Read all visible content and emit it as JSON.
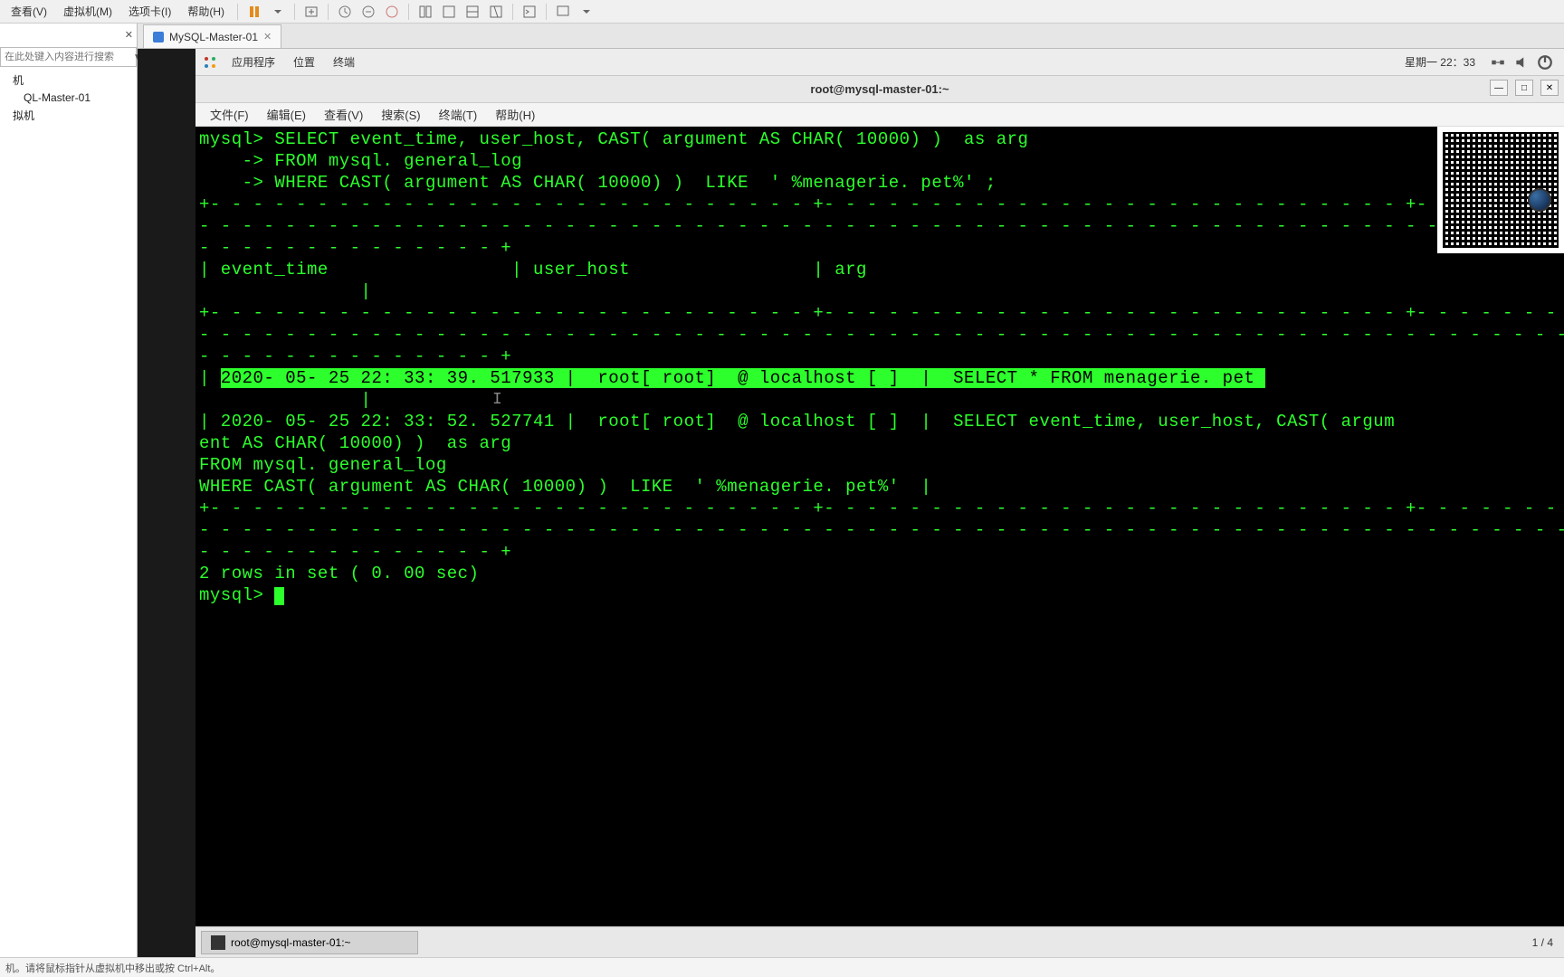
{
  "vm_menu": {
    "m0": "查看(V)",
    "m1": "虚拟机(M)",
    "m2": "选项卡(I)",
    "m3": "帮助(H)"
  },
  "sidebar": {
    "search_placeholder": "在此处键入内容进行搜索",
    "n0": "机",
    "n1": "QL-Master-01",
    "n2": "拟机"
  },
  "tab": {
    "label": "MySQL-Master-01"
  },
  "gnome": {
    "apps": "应用程序",
    "places": "位置",
    "terminal": "终端",
    "clock": "星期一  22：33"
  },
  "term": {
    "title": "root@mysql-master-01:~",
    "menu": {
      "file": "文件(F)",
      "edit": "编辑(E)",
      "view": "查看(V)",
      "search": "搜索(S)",
      "terminal": "终端(T)",
      "help": "帮助(H)"
    },
    "l1": "mysql> SELECT event_time, user_host, CAST( argument AS CHAR( 10000) )  as arg",
    "l2": "    -> FROM mysql. general_log",
    "l3": "    -> WHERE CAST( argument AS CHAR( 10000) )  LIKE  ' %menagerie. pet%' ;",
    "l4": "+- - - - - - - - - - - - - - - - - - - - - - - - - - - - +- - - - - - - - - - - - - - - - - - - - - - - - - - - +- - - - - - - - - - - - - - - - - - - - - - - - - - - - - - - - - - -",
    "l5": "- - - - - - - - - - - - - - - - - - - - - - - - - - - - - - - - - - - - - - - - - - - - - - - - - - - - - - - - - - - - - - - - - - - - - - - - - - - - - - - - - - - - - - - - - - - - - - - - - -",
    "l6": "- - - - - - - - - - - - - - +",
    "l7": "| event_time                 | user_host                 | arg",
    "l8": "               |",
    "l9": "+- - - - - - - - - - - - - - - - - - - - - - - - - - - - +- - - - - - - - - - - - - - - - - - - - - - - - - - - +- - - - - - - - - - - - - - - - - - - - - - - - - - - - - - - - - - -",
    "l10": "- - - - - - - - - - - - - - - - - - - - - - - - - - - - - - - - - - - - - - - - - - - - - - - - - - - - - - - - - - - - - - - - - - - - - - - - - - - - - - - - - - - - - - - - - - - - - - - - - -",
    "l11": "- - - - - - - - - - - - - - +",
    "l12a": "| ",
    "l12b": "2020- 05- 25 22: 33: 39. 517933 |  root[ root]  @ localhost [ ]  |  SELECT * FROM menagerie. pet ",
    "l13": "               |",
    "l14": "| 2020- 05- 25 22: 33: 52. 527741 |  root[ root]  @ localhost [ ]  |  SELECT event_time, user_host, CAST( argum",
    "l15": "ent AS CHAR( 10000) )  as arg",
    "l16": "FROM mysql. general_log",
    "l17": "WHERE CAST( argument AS CHAR( 10000) )  LIKE  ' %menagerie. pet%'  |",
    "l18": "+- - - - - - - - - - - - - - - - - - - - - - - - - - - - +- - - - - - - - - - - - - - - - - - - - - - - - - - - +- - - - - - - - - - - - - - - - - - - - - - - - - - - - - - - - - - -",
    "l19": "- - - - - - - - - - - - - - - - - - - - - - - - - - - - - - - - - - - - - - - - - - - - - - - - - - - - - - - - - - - - - - - - - - - - - - - - - - - - - - - - - - - - - - - - - - - - - - - - - -",
    "l20": "- - - - - - - - - - - - - - +",
    "l21": "2 rows in set ( 0. 00 sec)",
    "l22": "",
    "l23": "mysql> "
  },
  "taskbar": {
    "item": "root@mysql-master-01:~",
    "ws": "1 / 4"
  },
  "status": "机。请将鼠标指针从虚拟机中移出或按 Ctrl+Alt。"
}
